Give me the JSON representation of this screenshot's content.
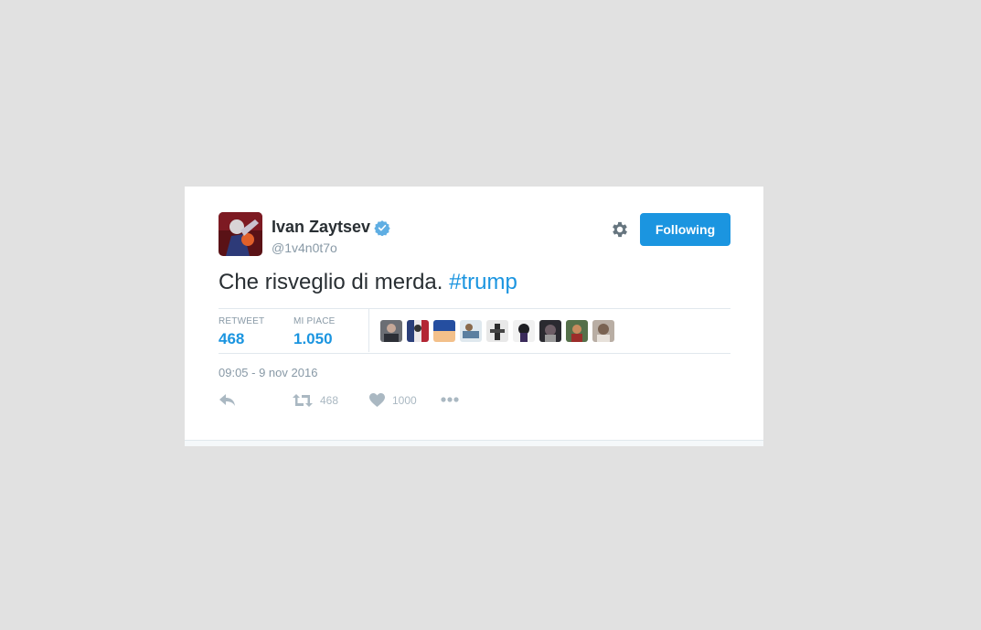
{
  "tweet": {
    "author_name": "Ivan Zaytsev",
    "author_handle": "@1v4n0t7o",
    "follow_label": "Following",
    "text_main": "Che risveglio di merda.",
    "text_hashtag": "#trump",
    "timestamp": "09:05 - 9 nov 2016"
  },
  "stats": {
    "retweet_label": "RETWEET",
    "retweet_value": "468",
    "likes_label": "MI PIACE",
    "likes_value": "1.050",
    "liker_count": 9
  },
  "actions": {
    "reply_icon": "reply-icon",
    "retweet_icon": "retweet-icon",
    "retweet_count": "468",
    "like_icon": "heart-icon",
    "like_count": "1000",
    "more_icon": "more-icon"
  },
  "colors": {
    "accent": "#1b95e0",
    "text": "#292f33",
    "muted": "#8899a6",
    "background": "#e1e1e1"
  }
}
